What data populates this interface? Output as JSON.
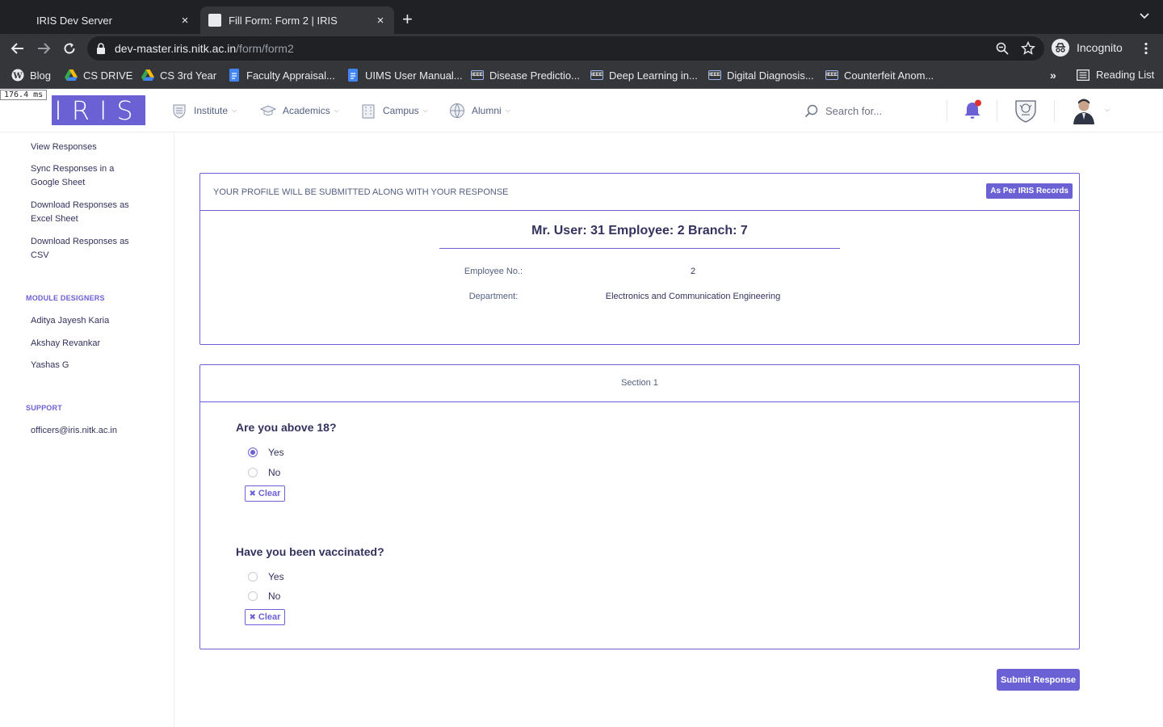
{
  "browser": {
    "tabs": [
      {
        "title": "IRIS Dev Server",
        "close": "×"
      },
      {
        "title": "Fill Form: Form 2 | IRIS",
        "close": "×"
      }
    ],
    "new_tab": "+",
    "url_host": "dev-master.iris.nitk.ac.in",
    "url_path": "/form/form2",
    "profile_label": "Incognito",
    "bookmarks": [
      "Blog",
      "CS DRIVE",
      "CS 3rd Year",
      "Faculty Appraisal...",
      "UIMS User Manual...",
      "Disease Predictio...",
      "Deep Learning in...",
      "Digital Diagnosis...",
      "Counterfeit Anom..."
    ],
    "bookmarks_more": "»",
    "reading_list": "Reading List"
  },
  "timing": "176.4 ms",
  "header": {
    "logo": "IRIS",
    "nav": [
      "Institute",
      "Academics",
      "Campus",
      "Alumni"
    ],
    "search_placeholder": "Search for..."
  },
  "sidebar": {
    "links": [
      "View Responses",
      "Sync Responses in a Google Sheet",
      "Download Responses as Excel Sheet",
      "Download Responses as CSV"
    ],
    "designers_heading": "MODULE DESIGNERS",
    "designers": [
      "Aditya Jayesh Karia",
      "Akshay Revankar",
      "Yashas G"
    ],
    "support_heading": "SUPPORT",
    "support_email": "officers@iris.nitk.ac.in"
  },
  "profile": {
    "heading": "YOUR PROFILE WILL BE SUBMITTED ALONG WITH YOUR RESPONSE",
    "badge": "As Per IRIS Records",
    "name": "Mr. User: 31 Employee: 2 Branch: 7",
    "fields": [
      {
        "label": "Employee No.:",
        "value": "2"
      },
      {
        "label": "Department:",
        "value": "Electronics and Communication Engineering"
      }
    ]
  },
  "form": {
    "section_title": "Section 1",
    "questions": [
      {
        "text": "Are you above 18?",
        "options": [
          "Yes",
          "No"
        ],
        "selected": "Yes"
      },
      {
        "text": "Have you been vaccinated?",
        "options": [
          "Yes",
          "No"
        ],
        "selected": null
      }
    ],
    "clear_label": "Clear",
    "submit_label": "Submit Response"
  },
  "colors": {
    "accent": "#6b61d4",
    "chrome_dark": "#202124",
    "chrome_mid": "#35363a",
    "bell": "#6b61d4",
    "notification_dot": "#e03131"
  }
}
